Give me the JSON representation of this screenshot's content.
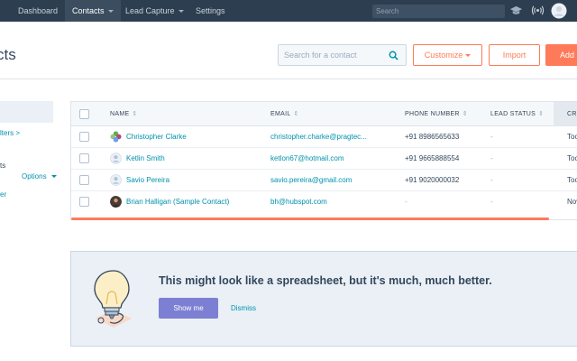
{
  "nav": {
    "items": [
      {
        "label": "Dashboard"
      },
      {
        "label": "Contacts"
      },
      {
        "label": "Lead Capture"
      },
      {
        "label": "Settings"
      }
    ],
    "search_placeholder": "Search"
  },
  "page": {
    "title": "cts",
    "search_placeholder": "Search for a contact",
    "customize_label": "Customize",
    "import_label": "Import",
    "add_label": "Add"
  },
  "sidebar": {
    "filters_link": "lters >",
    "section_label": "ts",
    "options_label": "Options",
    "item_label": "er"
  },
  "table": {
    "headers": {
      "name": "NAME",
      "email": "EMAIL",
      "phone": "PHONE NUMBER",
      "lead_status": "LEAD STATUS",
      "created": "CRE"
    },
    "rows": [
      {
        "name": "Christopher Clarke",
        "email": "christopher.charke@pragtec...",
        "phone": "+91 8986565633",
        "lead_status": "-",
        "created": "Too"
      },
      {
        "name": "Ketlin Smith",
        "email": "ketlon67@hotmail.com",
        "phone": "+91 9665888554",
        "lead_status": "-",
        "created": "Too"
      },
      {
        "name": "Savio Pereira",
        "email": "savio.pereira@gmail.com",
        "phone": "+91 9020000032",
        "lead_status": "-",
        "created": "Too"
      },
      {
        "name": "Brian Halligan (Sample Contact)",
        "email": "bh@hubspot.com",
        "phone": "-",
        "lead_status": "-",
        "created": "Nov"
      }
    ]
  },
  "promo": {
    "title": "This might look like a spreadsheet, but it's much, much better.",
    "show_me_label": "Show me",
    "dismiss_label": "Dismiss"
  },
  "colors": {
    "nav_bg": "#2d3e50",
    "accent": "#ff7a59",
    "link": "#0091ae",
    "promo_button": "#7c7fd2"
  }
}
